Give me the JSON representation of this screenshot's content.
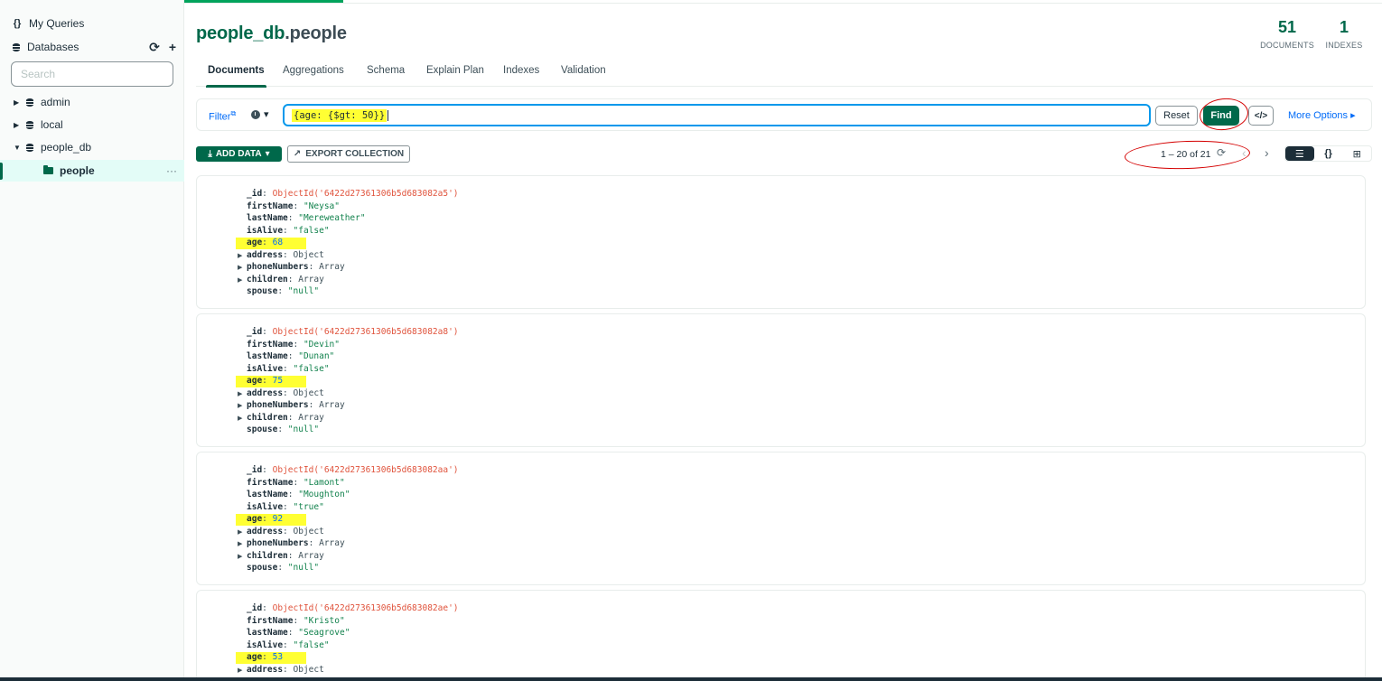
{
  "sidebar": {
    "my_queries_label": "My Queries",
    "databases_label": "Databases",
    "refresh_glyph": "⟳",
    "add_glyph": "+",
    "search_placeholder": "Search",
    "databases": [
      {
        "name": "admin"
      },
      {
        "name": "local"
      },
      {
        "name": "people_db"
      }
    ],
    "collection": {
      "name": "people",
      "menu_glyph": "···"
    }
  },
  "header": {
    "db_name": "people_db",
    "coll_name": ".people",
    "documents_count": "51",
    "documents_label": "DOCUMENTS",
    "indexes_count": "1",
    "indexes_label": "INDEXES"
  },
  "tabs": [
    "Documents",
    "Aggregations",
    "Schema",
    "Explain Plan",
    "Indexes",
    "Validation"
  ],
  "querybar": {
    "filter_label": "Filter",
    "filter_sup": "⧉",
    "history_glyph": "▾",
    "query_text": "{age: {$gt: 50}}",
    "reset_label": "Reset",
    "find_label": "Find",
    "code_label": "</>",
    "more_options_label": "More Options ▸"
  },
  "actions": {
    "add_data_label": "ADD DATA",
    "add_data_caret": "▾",
    "export_label": "EXPORT COLLECTION",
    "pager_text": "1 – 20 of 21"
  },
  "documents": [
    {
      "_id": "ObjectId('6422d27361306b5d683082a5')",
      "firstName": "\"Neysa\"",
      "lastName": "\"Mereweather\"",
      "isAlive": "\"false\"",
      "age": "68",
      "address": "Object",
      "phoneNumbers": "Array",
      "children": "Array",
      "spouse": "\"null\""
    },
    {
      "_id": "ObjectId('6422d27361306b5d683082a8')",
      "firstName": "\"Devin\"",
      "lastName": "\"Dunan\"",
      "isAlive": "\"false\"",
      "age": "75",
      "address": "Object",
      "phoneNumbers": "Array",
      "children": "Array",
      "spouse": "\"null\""
    },
    {
      "_id": "ObjectId('6422d27361306b5d683082aa')",
      "firstName": "\"Lamont\"",
      "lastName": "\"Moughton\"",
      "isAlive": "\"true\"",
      "age": "92",
      "address": "Object",
      "phoneNumbers": "Array",
      "children": "Array",
      "spouse": "\"null\""
    },
    {
      "_id": "ObjectId('6422d27361306b5d683082ae')",
      "firstName": "\"Kristo\"",
      "lastName": "\"Seagrove\"",
      "isAlive": "\"false\"",
      "age": "53",
      "address": "Object"
    }
  ],
  "field_keys": {
    "_id": "_id",
    "firstName": "firstName",
    "lastName": "lastName",
    "isAlive": "isAlive",
    "age": "age",
    "address": "address",
    "phoneNumbers": "phoneNumbers",
    "children": "children",
    "spouse": "spouse"
  },
  "colors": {
    "brand_green": "#00684a",
    "link_blue": "#016bf8",
    "highlight_yellow": "#ffff33",
    "annotation_red": "#d40000"
  }
}
